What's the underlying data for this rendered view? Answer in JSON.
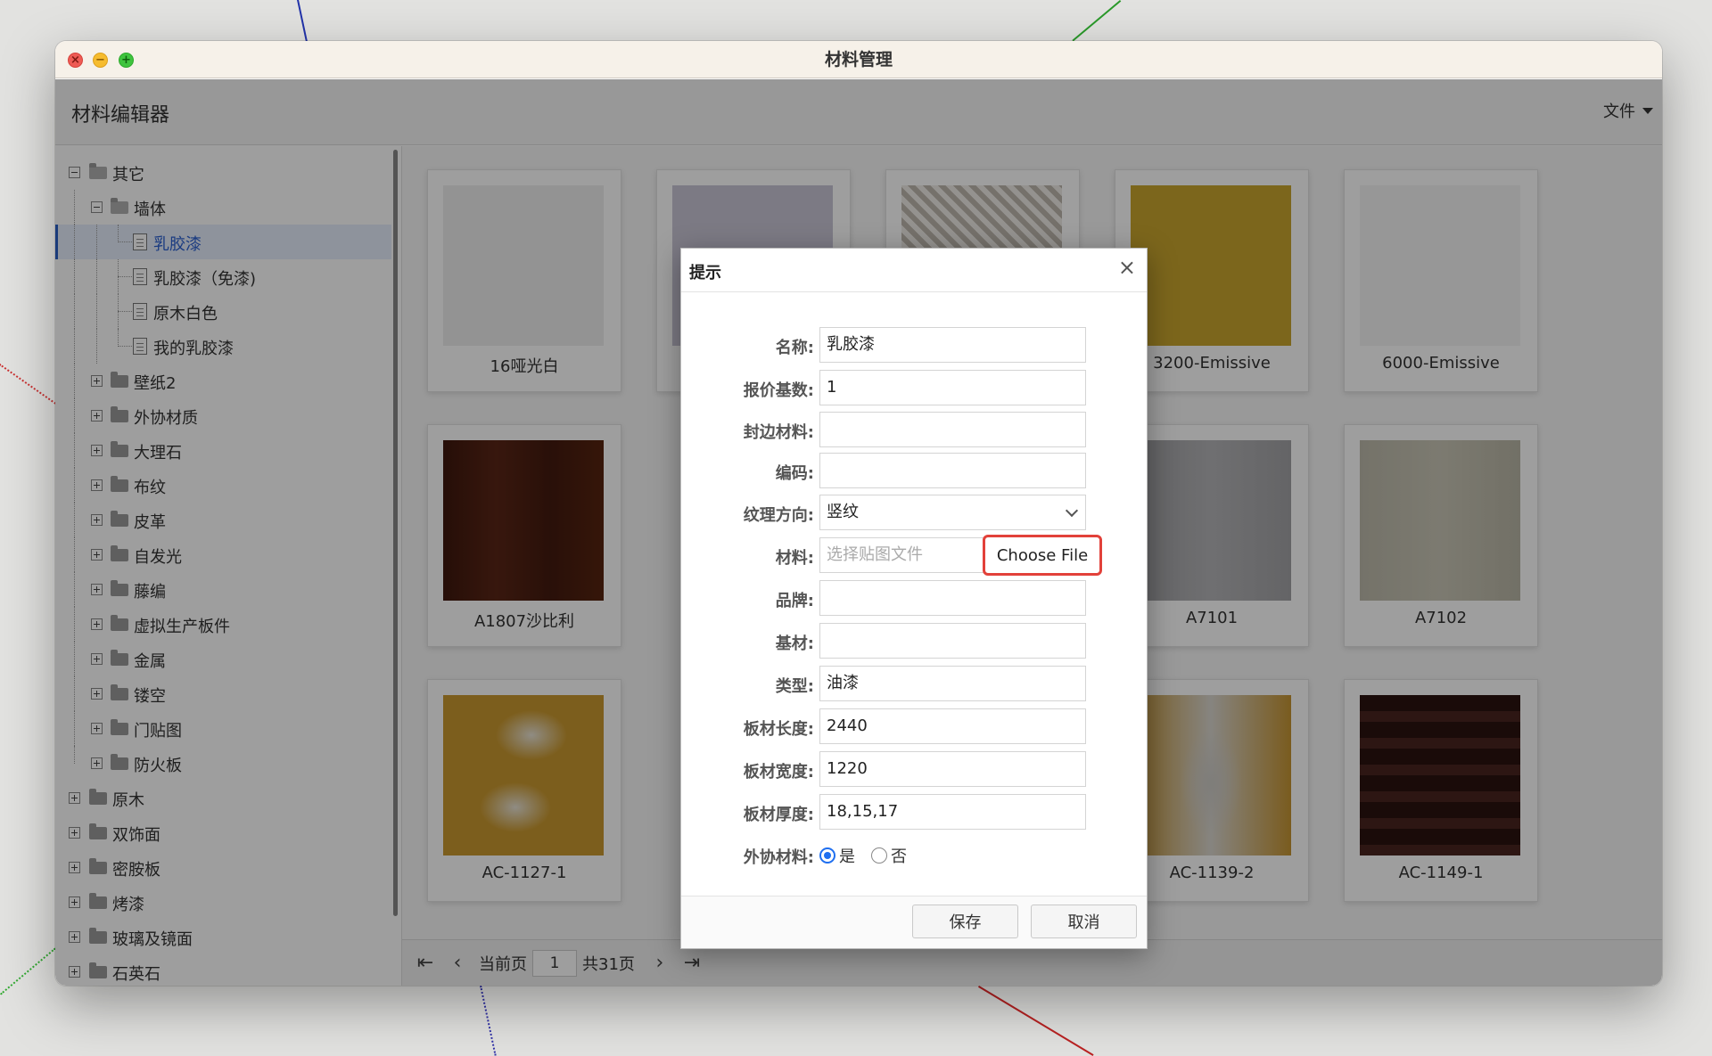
{
  "window": {
    "title": "材料管理"
  },
  "app": {
    "title": "材料编辑器",
    "file_menu": "文件"
  },
  "tree": {
    "items": [
      {
        "label": "其它",
        "icon": "folder-open-icon"
      },
      {
        "label": "墙体",
        "icon": "folder-open-icon"
      },
      {
        "label": "乳胶漆",
        "icon": "document-icon",
        "selected": true
      },
      {
        "label": "乳胶漆（免漆)",
        "icon": "document-icon"
      },
      {
        "label": "原木白色",
        "icon": "document-icon"
      },
      {
        "label": "我的乳胶漆",
        "icon": "document-icon"
      },
      {
        "label": "壁纸2",
        "icon": "folder-icon"
      },
      {
        "label": "外协材质",
        "icon": "folder-icon"
      },
      {
        "label": "大理石",
        "icon": "folder-icon"
      },
      {
        "label": "布纹",
        "icon": "folder-icon"
      },
      {
        "label": "皮革",
        "icon": "folder-icon"
      },
      {
        "label": "自发光",
        "icon": "folder-icon"
      },
      {
        "label": "藤编",
        "icon": "folder-icon"
      },
      {
        "label": "虚拟生产板件",
        "icon": "folder-icon"
      },
      {
        "label": "金属",
        "icon": "folder-icon"
      },
      {
        "label": "镂空",
        "icon": "folder-icon"
      },
      {
        "label": "门贴图",
        "icon": "folder-icon"
      },
      {
        "label": "防火板",
        "icon": "folder-icon"
      },
      {
        "label": "原木",
        "icon": "folder-icon"
      },
      {
        "label": "双饰面",
        "icon": "folder-icon"
      },
      {
        "label": "密胺板",
        "icon": "folder-icon"
      },
      {
        "label": "烤漆",
        "icon": "folder-icon"
      },
      {
        "label": "玻璃及镜面",
        "icon": "folder-icon"
      },
      {
        "label": "石英石",
        "icon": "folder-icon"
      }
    ]
  },
  "materials": [
    {
      "label": "16哑光白",
      "color": "#eeeeee"
    },
    {
      "label": "",
      "color": "#c9c6d6"
    },
    {
      "label": "",
      "color": "#d9d4cc"
    },
    {
      "label": "3200-Emissive",
      "color": "#c9a52e"
    },
    {
      "label": "6000-Emissive",
      "color": "#f4f4f4"
    },
    {
      "label": "A1807沙比利",
      "color": "#4a1f12"
    },
    {
      "label": "A7101",
      "color": "#a7a7aa"
    },
    {
      "label": "A7102",
      "color": "#c2bfb0"
    },
    {
      "label": "AC-1127-1",
      "color": "#c9a062"
    },
    {
      "label": "AC-1139-2",
      "color": "#b89a6a"
    },
    {
      "label": "AC-1149-1",
      "color": "#2e1512"
    }
  ],
  "pager": {
    "first_icon": "first-page-icon",
    "prev_icon": "prev-page-icon",
    "next_icon": "next-page-icon",
    "last_icon": "last-page-icon",
    "current_label": "当前页",
    "current_value": "1",
    "total_label": "共31页"
  },
  "dialog": {
    "title": "提示",
    "close": "×",
    "fields": {
      "name": {
        "label": "名称:",
        "value": "乳胶漆"
      },
      "quote_base": {
        "label": "报价基数:",
        "value": "1"
      },
      "edge_material": {
        "label": "封边材料:",
        "value": ""
      },
      "code": {
        "label": "编码:",
        "value": ""
      },
      "grain": {
        "label": "纹理方向:",
        "value": "竖纹"
      },
      "material": {
        "label": "材料:",
        "placeholder": "选择贴图文件",
        "button": "Choose File"
      },
      "brand": {
        "label": "品牌:",
        "value": ""
      },
      "substrate": {
        "label": "基材:",
        "value": ""
      },
      "type": {
        "label": "类型:",
        "value": "油漆"
      },
      "length": {
        "label": "板材长度:",
        "value": "2440"
      },
      "width": {
        "label": "板材宽度:",
        "value": "1220"
      },
      "thickness": {
        "label": "板材厚度:",
        "value": "18,15,17"
      },
      "outsourced": {
        "label": "外协材料:",
        "yes": "是",
        "no": "否"
      }
    },
    "save": "保存",
    "cancel": "取消"
  }
}
